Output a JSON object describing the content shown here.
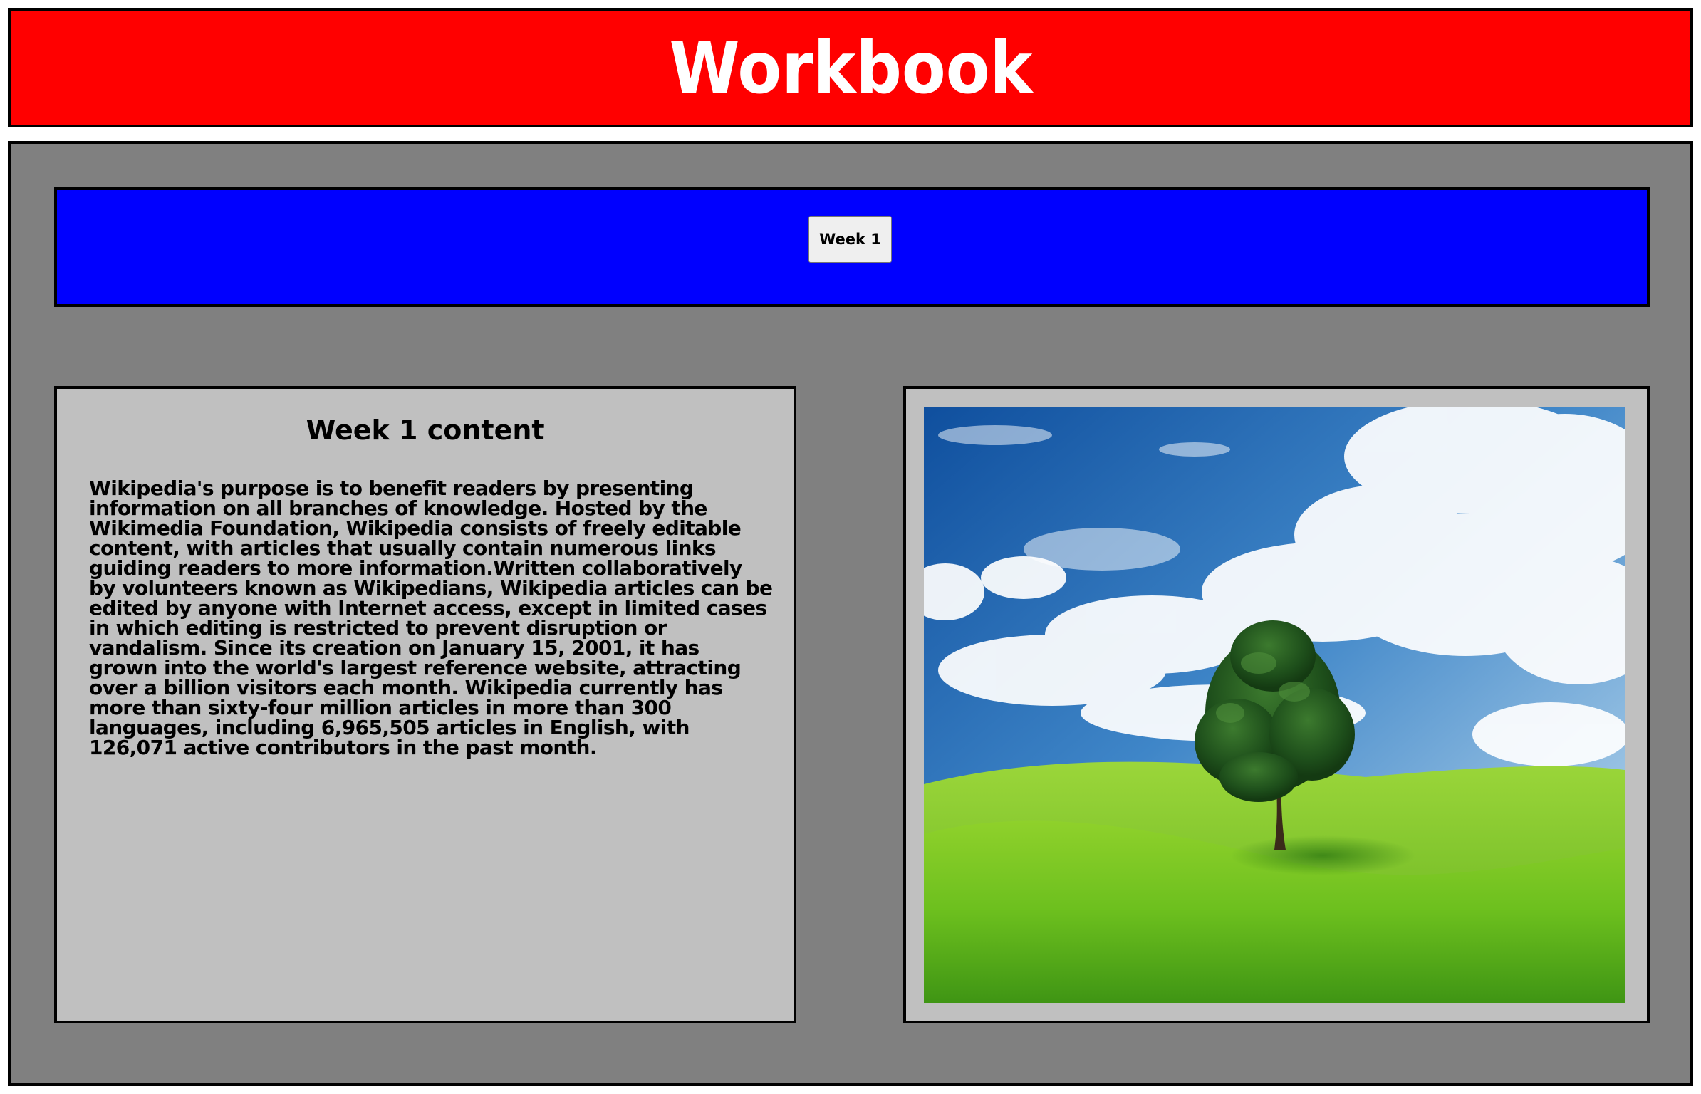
{
  "header": {
    "title": "Workbook"
  },
  "tabs": [
    {
      "label": "Week 1"
    }
  ],
  "content": {
    "title": "Week 1 content",
    "body": "Wikipedia's purpose is to benefit readers by presenting information on all branches of knowledge. Hosted by the Wikimedia Foundation, Wikipedia consists of freely editable content, with articles that usually contain numerous links guiding readers to more information.Written collaboratively by volunteers known as Wikipedians, Wikipedia articles can be edited by anyone with Internet access, except in limited cases in which editing is restricted to prevent disruption or vandalism. Since its creation on January 15, 2001, it has grown into the world's largest reference website, attracting over a billion visitors each month. Wikipedia currently has more than sixty-four million articles in more than 300 languages, including 6,965,505 articles in English, with 126,071 active contributors in the past month."
  },
  "colors": {
    "header_bg": "#ff0000",
    "workspace_bg": "#808080",
    "tabbar_bg": "#0000ff",
    "panel_bg": "#c0c0c0",
    "border": "#000000"
  }
}
